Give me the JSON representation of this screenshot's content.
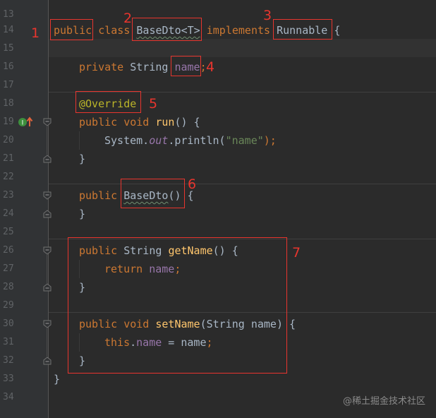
{
  "editor": {
    "line_numbers": [
      "13",
      "14",
      "15",
      "16",
      "17",
      "18",
      "19",
      "20",
      "21",
      "22",
      "23",
      "24",
      "25",
      "26",
      "27",
      "28",
      "29",
      "30",
      "31",
      "32",
      "33",
      "34"
    ],
    "code": {
      "l14": {
        "public": "public",
        "class": "class",
        "cls": "BaseDto",
        "gen": "<T>",
        "implements": "implements",
        "iface": "Runnable",
        "brace": "{"
      },
      "l16": {
        "private": "private",
        "type": "String",
        "field": "name",
        "semi": ";"
      },
      "l18": {
        "annotation": "@Override"
      },
      "l19": {
        "public": "public",
        "void": "void",
        "method": "run",
        "parens": "()",
        "brace": "{"
      },
      "l20": {
        "system": "System.",
        "out": "out",
        "println": ".println(",
        "str": "\"name\"",
        "end": ");"
      },
      "l21": {
        "brace": "}"
      },
      "l23": {
        "public": "public",
        "ctor": "BaseDto",
        "parens": "()",
        "brace": "{"
      },
      "l24": {
        "brace": "}"
      },
      "l26": {
        "public": "public",
        "type": "String",
        "method": "getName",
        "parens": "()",
        "brace": "{"
      },
      "l27": {
        "return": "return",
        "field": "name",
        "semi": ";"
      },
      "l28": {
        "brace": "}"
      },
      "l30": {
        "public": "public",
        "void": "void",
        "method": "setName",
        "open": "(",
        "ptype": "String",
        "pname": "name",
        "close": ")",
        "brace": "{"
      },
      "l31": {
        "this": "this",
        "dot": ".",
        "field": "name",
        "assign": " = name",
        "semi": ";"
      },
      "l32": {
        "brace": "}"
      },
      "l33": {
        "brace": "}"
      }
    }
  },
  "annotations": {
    "labels": [
      "1",
      "2",
      "3",
      "4",
      "5",
      "6",
      "7"
    ]
  },
  "gutter_icons": {
    "line19": "implements-method-icon"
  },
  "watermark": "@稀土掘金技术社区",
  "colors": {
    "background": "#2b2b2b",
    "keyword": "#cc7832",
    "field": "#9876aa",
    "method": "#ffc66d",
    "string": "#6a8759",
    "annotation": "#bbb529",
    "highlight_box": "#e8352e"
  }
}
